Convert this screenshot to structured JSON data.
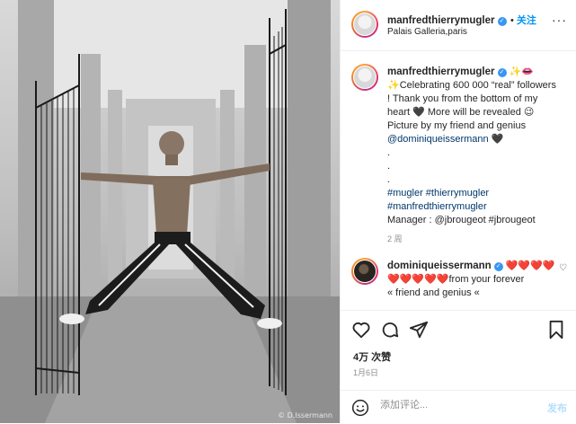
{
  "photo": {
    "credit": "© D.Issermann"
  },
  "header": {
    "username": "manfredthierrymugler",
    "verified_glyph": "✓",
    "follow_label": "关注",
    "location": "Palais Galleria,paris",
    "more_label": "···"
  },
  "caption": {
    "username": "manfredthierrymugler",
    "emoji_suffix": "✨👄",
    "lines": [
      "✨Celebrating 600 000 “real” followers",
      "! Thank you from the bottom of my",
      "heart 🖤 More will be revealed 😉",
      "Picture by my friend and genius",
      "@dominiqueissermann 🖤",
      ".",
      ".",
      ".",
      "#mugler #thierrymugler",
      "#manfredthierrymugler",
      "Manager : @jbrougeot #jbrougeot"
    ],
    "time": "2 周"
  },
  "reply": {
    "username": "dominiqueissermann",
    "hearts_inline": "❤️❤️❤️❤️",
    "line2": "❤️❤️❤️❤️❤️from your forever",
    "line3": "« friend and genius «"
  },
  "stats": {
    "likes": "4万 次赞",
    "date": "1月6日"
  },
  "composer": {
    "placeholder": "添加评论...",
    "post_label": "发布"
  },
  "icons": [
    "more-icon",
    "verified-icon",
    "heart-icon",
    "comment-icon",
    "share-icon",
    "save-icon",
    "emoji-icon"
  ],
  "colors": {
    "accent": "#0095f6",
    "hashtag": "#00376b",
    "muted": "#8e8e8e",
    "verified": "#3897f0"
  }
}
